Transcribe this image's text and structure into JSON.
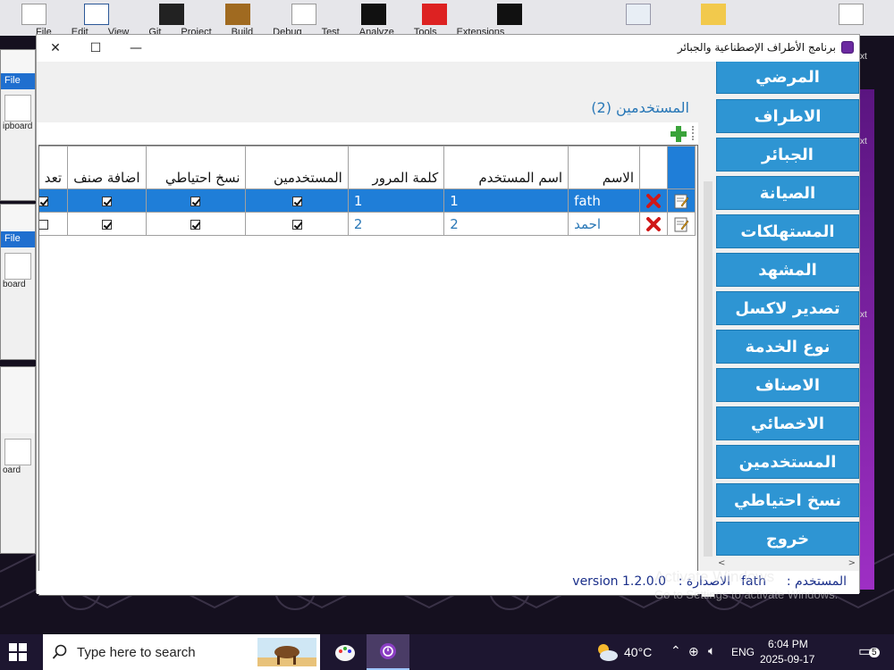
{
  "desktop": {
    "vs_menu": [
      "File",
      "Edit",
      "View",
      "Git",
      "Project",
      "Build",
      "Debug",
      "Test",
      "Analyze",
      "Tools",
      "Extensions"
    ],
    "left_windows": [
      {
        "title": "File",
        "label": "ipboard"
      },
      {
        "title": "File",
        "label": "board"
      },
      {
        "title": "",
        "label": "oard"
      }
    ],
    "edge_texts": [
      "xt",
      "xt",
      "xt"
    ]
  },
  "window": {
    "title": "برنامج الأطراف الإصطناعية والجبائر",
    "controls": {
      "close": "✕",
      "maximize": "☐",
      "minimize": "—"
    }
  },
  "sidebar": {
    "items": [
      {
        "label": "المرضي"
      },
      {
        "label": "الاطراف"
      },
      {
        "label": "الجبائر"
      },
      {
        "label": "الصيانة"
      },
      {
        "label": "المستهلكات"
      },
      {
        "label": "المشهد"
      },
      {
        "label": "تصدير لاكسل"
      },
      {
        "label": "نوع الخدمة"
      },
      {
        "label": "الاصناف"
      },
      {
        "label": "الاخصائي"
      },
      {
        "label": "المستخدمين"
      },
      {
        "label": "نسخ احتياطي"
      },
      {
        "label": "خروج"
      }
    ]
  },
  "main": {
    "section_title": "المستخدمين (2)",
    "table": {
      "headers": [
        "الاسم",
        "اسم المستخدم",
        "كلمة المرور",
        "المستخدمين",
        "نسخ احتياطي",
        "اضافة صنف",
        "تعد"
      ],
      "rows": [
        {
          "name": "fath",
          "username": "1",
          "password": "1",
          "users": true,
          "backup": true,
          "add_item": true,
          "edit": true,
          "selected": true
        },
        {
          "name": "احمد",
          "username": "2",
          "password": "2",
          "users": true,
          "backup": true,
          "add_item": true,
          "edit": false,
          "selected": false
        }
      ]
    }
  },
  "status": {
    "user_label": "المستخدم :",
    "user_value": "fath",
    "version_label": "الاصدارة :",
    "version_value": "version 1.2.0.0"
  },
  "watermark": {
    "line1": "Activate Windows",
    "line2": "Go to Settings to activate Windows."
  },
  "taskbar": {
    "search_placeholder": "Type here to search",
    "temperature": "40°C",
    "language": "ENG",
    "time": "6:04 PM",
    "date": "2025-09-17",
    "notifications": "5"
  },
  "colors": {
    "accent": "#2e95d3",
    "selection": "#1f7ed8",
    "title_text": "#2a78b7",
    "status_text": "#1a2f8a"
  }
}
